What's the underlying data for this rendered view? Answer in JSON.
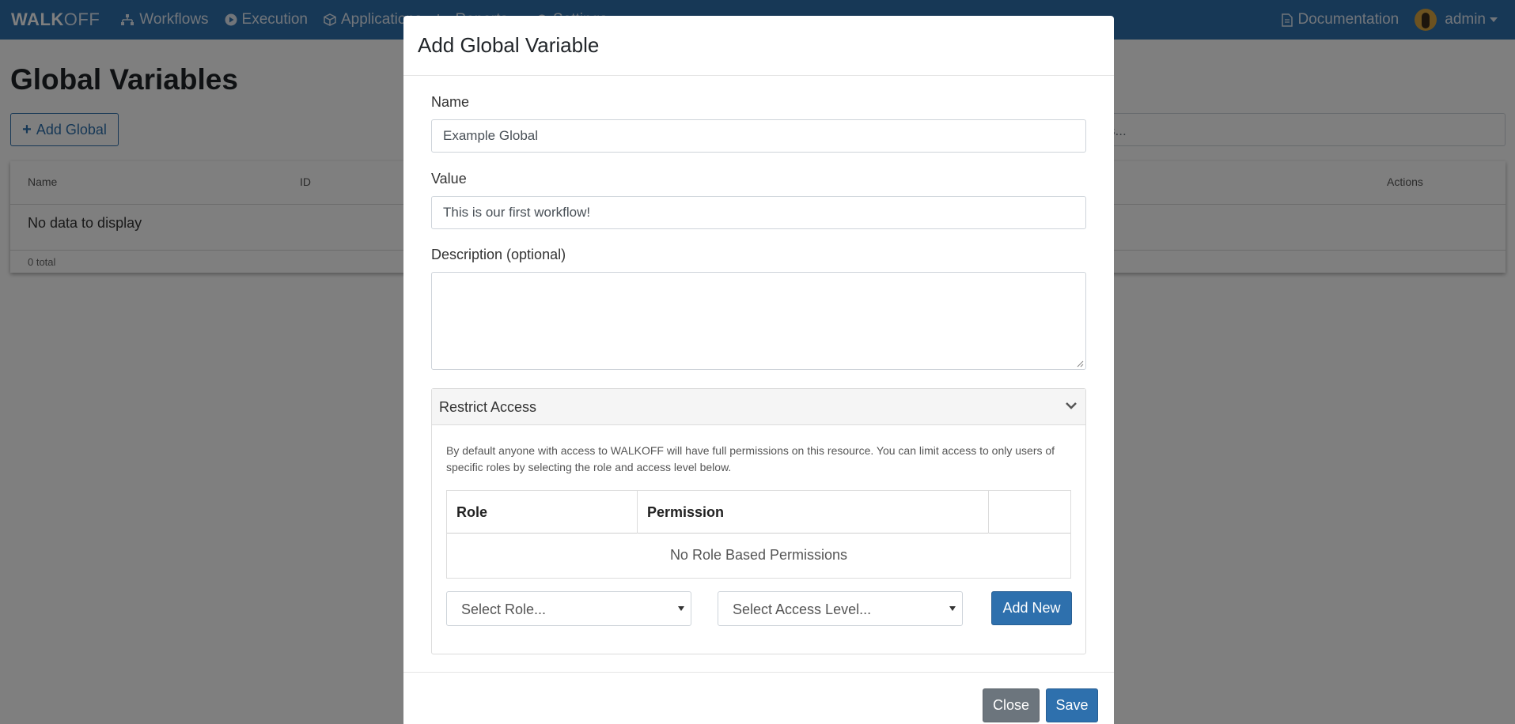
{
  "navbar": {
    "brand_bold": "WALK",
    "brand_light": "OFF",
    "items": [
      {
        "label": "Workflows",
        "icon": "sitemap-icon"
      },
      {
        "label": "Execution",
        "icon": "play-circle-icon"
      },
      {
        "label": "Applications",
        "icon": "cube-icon"
      },
      {
        "label": "Reports",
        "icon": "chart-icon"
      },
      {
        "label": "Settings",
        "icon": "gear-icon"
      }
    ],
    "documentation": "Documentation",
    "user": "admin"
  },
  "page": {
    "title": "Global Variables",
    "add_button": "Add Global",
    "search_placeholder_visible": "s...",
    "table": {
      "columns": [
        "Name",
        "ID",
        "Actions"
      ],
      "empty_message": "No data to display",
      "total": "0 total"
    }
  },
  "modal": {
    "title": "Add Global Variable",
    "name_label": "Name",
    "name_value": "Example Global",
    "value_label": "Value",
    "value_value": "This is our first workflow!",
    "description_label": "Description (optional)",
    "description_value": "",
    "restrict_access": {
      "title": "Restrict Access",
      "description": "By default anyone with access to WALKOFF will have full permissions on this resource. You can limit access to only users of specific roles by selecting the role and access level below.",
      "columns": [
        "Role",
        "Permission",
        ""
      ],
      "empty_message": "No Role Based Permissions",
      "role_select": "Select Role...",
      "access_select": "Select Access Level...",
      "add_button": "Add New"
    },
    "close_button": "Close",
    "save_button": "Save"
  },
  "colors": {
    "navbar": "#2e70ad",
    "primary": "#2e70ad",
    "secondary": "#6c757d"
  }
}
